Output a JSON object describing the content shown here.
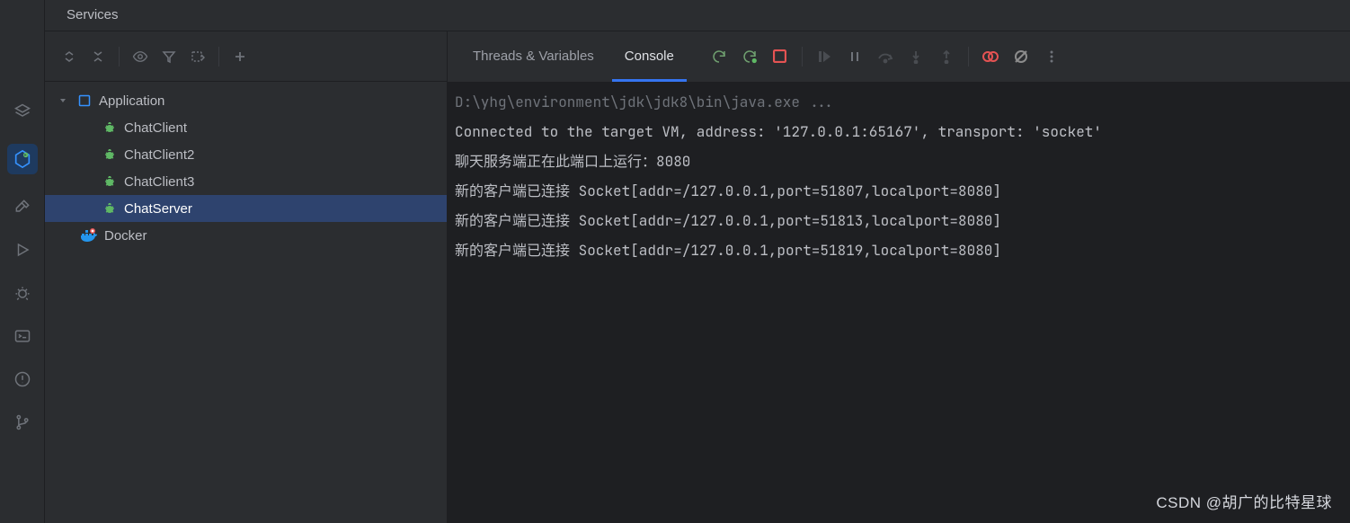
{
  "panel_title": "Services",
  "iconbar": {
    "items": [
      {
        "name": "layers-icon"
      },
      {
        "name": "plugin-play-icon",
        "active": true
      },
      {
        "name": "hammer-icon"
      },
      {
        "name": "run-icon"
      },
      {
        "name": "debug-icon"
      },
      {
        "name": "terminal-icon"
      },
      {
        "name": "alert-icon"
      },
      {
        "name": "git-branch-icon"
      }
    ]
  },
  "tree_toolbar": {
    "buttons": [
      "expand",
      "collapse",
      "view",
      "filter",
      "group",
      "add"
    ]
  },
  "tree": {
    "root_label": "Application",
    "items": [
      {
        "label": "ChatClient",
        "icon": "bug",
        "selected": false
      },
      {
        "label": "ChatClient2",
        "icon": "bug",
        "selected": false
      },
      {
        "label": "ChatClient3",
        "icon": "bug",
        "selected": false
      },
      {
        "label": "ChatServer",
        "icon": "bug",
        "selected": true
      }
    ],
    "docker_label": "Docker"
  },
  "console": {
    "tabs": [
      {
        "label": "Threads & Variables",
        "active": false
      },
      {
        "label": "Console",
        "active": true
      }
    ],
    "buttons": [
      "rerun",
      "rerun-debug",
      "stop",
      "resume",
      "pause",
      "step-over",
      "step-into",
      "step-out",
      "view-breakpoints",
      "mute-breakpoints",
      "more"
    ],
    "lines": [
      {
        "text": "D:\\yhg\\environment\\jdk\\jdk8\\bin\\java.exe ...",
        "dim": true
      },
      {
        "text": "Connected to the target VM, address: '127.0.0.1:65167', transport: 'socket'"
      },
      {
        "text": "聊天服务端正在此端口上运行：8080"
      },
      {
        "text": "新的客户端已连接 Socket[addr=/127.0.0.1,port=51807,localport=8080]"
      },
      {
        "text": "新的客户端已连接 Socket[addr=/127.0.0.1,port=51813,localport=8080]"
      },
      {
        "text": "新的客户端已连接 Socket[addr=/127.0.0.1,port=51819,localport=8080]"
      }
    ]
  },
  "watermark": "CSDN @胡广的比特星球"
}
